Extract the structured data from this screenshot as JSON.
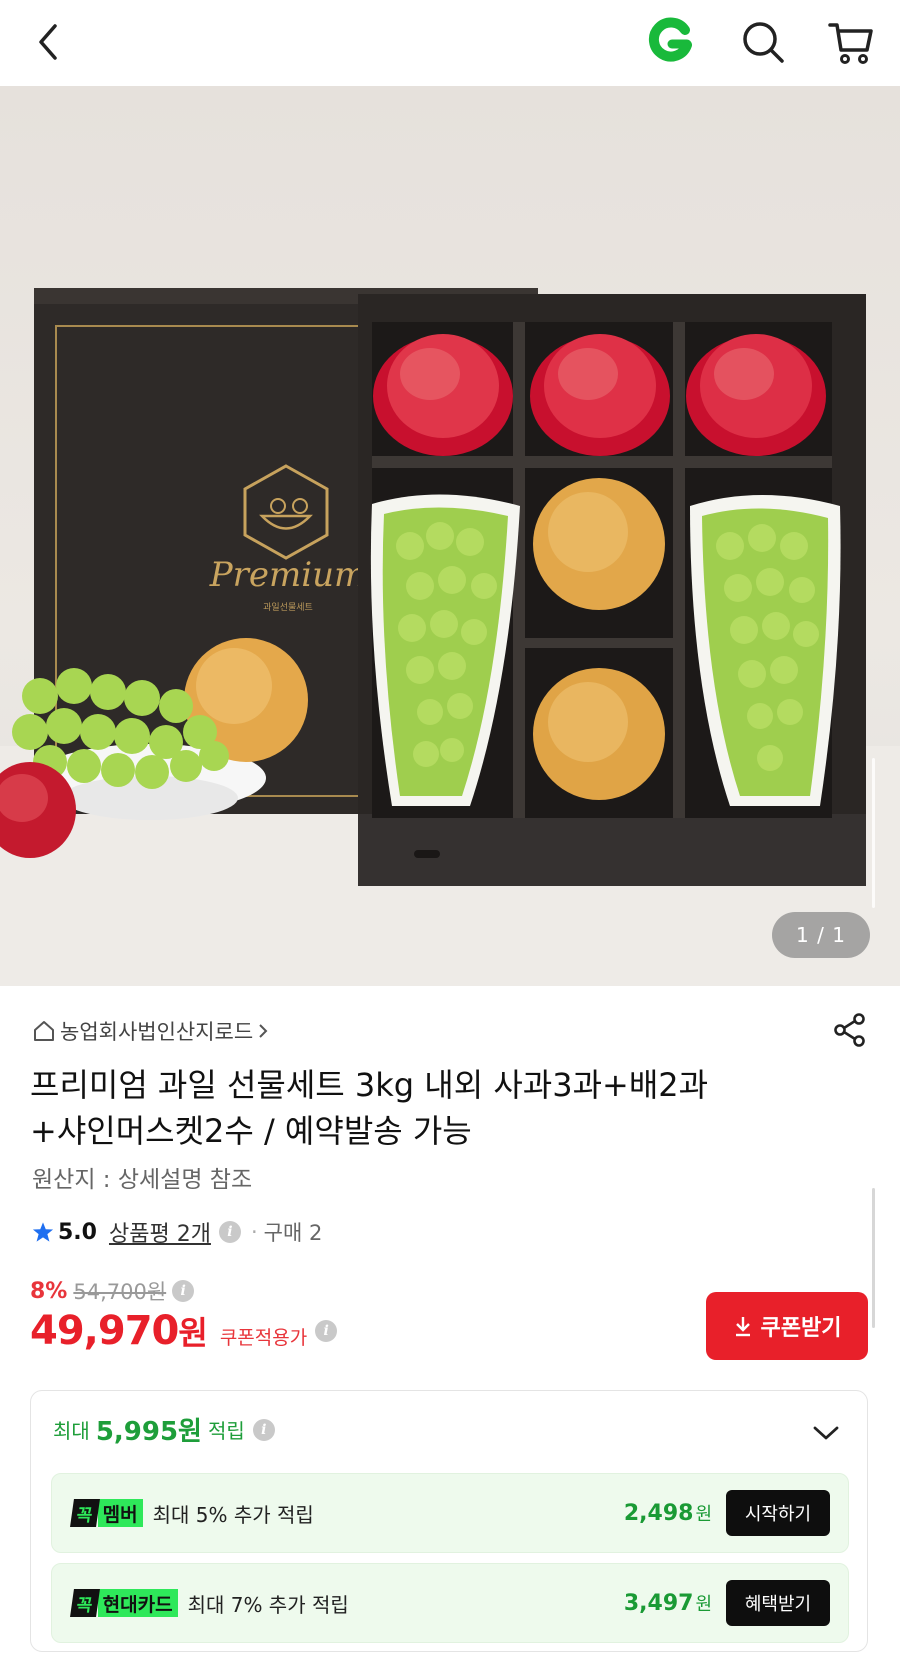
{
  "header": {
    "back_icon": "chevron-left-icon",
    "logo_text": "G",
    "search_icon": "search-icon",
    "cart_icon": "cart-icon"
  },
  "gallery": {
    "counter": "1 / 1",
    "box_brand": "Premium",
    "box_subtitle": "과일선물세트"
  },
  "product": {
    "seller": "농업회사법인산지로드",
    "title_line1": "프리미엄 과일 선물세트 3kg 내외 사과3과+배2과",
    "title_line2": "+샤인머스켓2수 / 예약발송 가능",
    "origin": "원산지 : 상세설명 참조",
    "rating": "5.0",
    "reviews_label": "상품평 2개",
    "purchase_label": "구매 2",
    "discount_rate": "8%",
    "original_price": "54,700원",
    "price": "49,970",
    "price_unit": "원",
    "coupon_price_label": "쿠폰적용가",
    "coupon_button": "쿠폰받기"
  },
  "reward": {
    "prefix": "최대",
    "amount": "5,995원",
    "suffix": "적립",
    "benefits": [
      {
        "badge_prefix": "꼭",
        "badge_name": "멤버",
        "desc": "최대 5% 추가 적립",
        "amount": "2,498",
        "unit": "원",
        "button": "시작하기"
      },
      {
        "badge_prefix": "꼭",
        "badge_name": "현대카드",
        "desc": "최대 7% 추가 적립",
        "amount": "3,497",
        "unit": "원",
        "button": "혜택받기"
      }
    ]
  },
  "colors": {
    "accent_red": "#e8202a",
    "accent_green": "#1e9e3a",
    "badge_green": "#2ee85a"
  }
}
